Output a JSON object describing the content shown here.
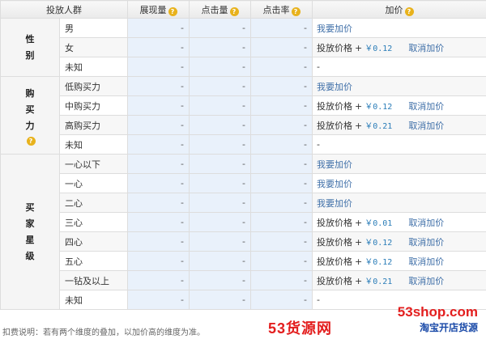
{
  "headers": {
    "audience": "投放人群",
    "impressions": "展现量",
    "clicks": "点击量",
    "ctr": "点击率",
    "bid": "加价"
  },
  "icon_help": "?",
  "groups": [
    {
      "label": "性别",
      "show_help": false,
      "rows": [
        {
          "label": "男",
          "impressions": "-",
          "clicks": "-",
          "ctr": "-",
          "bid": {
            "type": "add",
            "text": "我要加价"
          }
        },
        {
          "label": "女",
          "impressions": "-",
          "clicks": "-",
          "ctr": "-",
          "bid": {
            "type": "price",
            "prefix": "投放价格",
            "plus": "+",
            "value": "￥0.12",
            "cancel": "取消加价"
          }
        },
        {
          "label": "未知",
          "impressions": "-",
          "clicks": "-",
          "ctr": "-",
          "bid": {
            "type": "none",
            "text": "-"
          }
        }
      ]
    },
    {
      "label": "购买力",
      "show_help": true,
      "rows": [
        {
          "label": "低购买力",
          "impressions": "-",
          "clicks": "-",
          "ctr": "-",
          "bid": {
            "type": "add",
            "text": "我要加价"
          }
        },
        {
          "label": "中购买力",
          "impressions": "-",
          "clicks": "-",
          "ctr": "-",
          "bid": {
            "type": "price",
            "prefix": "投放价格",
            "plus": "+",
            "value": "￥0.12",
            "cancel": "取消加价"
          }
        },
        {
          "label": "高购买力",
          "impressions": "-",
          "clicks": "-",
          "ctr": "-",
          "bid": {
            "type": "price",
            "prefix": "投放价格",
            "plus": "+",
            "value": "￥0.21",
            "cancel": "取消加价"
          }
        },
        {
          "label": "未知",
          "impressions": "-",
          "clicks": "-",
          "ctr": "-",
          "bid": {
            "type": "none",
            "text": "-"
          }
        }
      ]
    },
    {
      "label": "买家星级",
      "show_help": false,
      "rows": [
        {
          "label": "一心以下",
          "impressions": "-",
          "clicks": "-",
          "ctr": "-",
          "bid": {
            "type": "add",
            "text": "我要加价"
          }
        },
        {
          "label": "一心",
          "impressions": "-",
          "clicks": "-",
          "ctr": "-",
          "bid": {
            "type": "add",
            "text": "我要加价"
          }
        },
        {
          "label": "二心",
          "impressions": "-",
          "clicks": "-",
          "ctr": "-",
          "bid": {
            "type": "add",
            "text": "我要加价"
          }
        },
        {
          "label": "三心",
          "impressions": "-",
          "clicks": "-",
          "ctr": "-",
          "bid": {
            "type": "price",
            "prefix": "投放价格",
            "plus": "+",
            "value": "￥0.01",
            "cancel": "取消加价"
          }
        },
        {
          "label": "四心",
          "impressions": "-",
          "clicks": "-",
          "ctr": "-",
          "bid": {
            "type": "price",
            "prefix": "投放价格",
            "plus": "+",
            "value": "￥0.12",
            "cancel": "取消加价"
          }
        },
        {
          "label": "五心",
          "impressions": "-",
          "clicks": "-",
          "ctr": "-",
          "bid": {
            "type": "price",
            "prefix": "投放价格",
            "plus": "+",
            "value": "￥0.12",
            "cancel": "取消加价"
          }
        },
        {
          "label": "一钻及以上",
          "impressions": "-",
          "clicks": "-",
          "ctr": "-",
          "bid": {
            "type": "price",
            "prefix": "投放价格",
            "plus": "+",
            "value": "￥0.21",
            "cancel": "取消加价"
          }
        },
        {
          "label": "未知",
          "impressions": "-",
          "clicks": "-",
          "ctr": "-",
          "bid": {
            "type": "none",
            "text": "-"
          }
        }
      ]
    }
  ],
  "footer_note": "扣费说明：若有两个维度的叠加，以加价高的维度为准。",
  "watermark": {
    "domain": "53shop.com",
    "brand": "53货源网",
    "tagline": "淘宝开店货源"
  },
  "colors": {
    "metric_col_bg": "#e9f1fb",
    "link": "#3f6fa8",
    "price": "#2b7db8",
    "help_icon": "#e8b21c",
    "watermark_red": "#e31e1e",
    "watermark_blue": "#1a4aa8"
  }
}
